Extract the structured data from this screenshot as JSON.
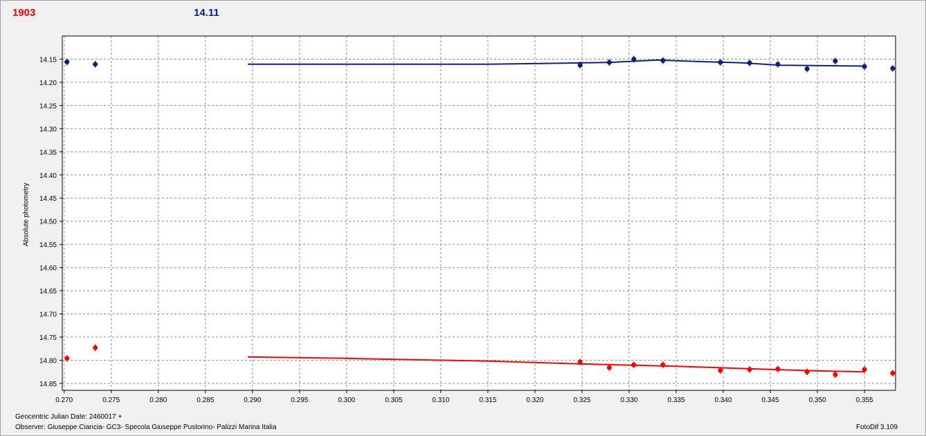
{
  "header": {
    "left_value": "1903",
    "right_value": "14.11"
  },
  "footer": {
    "julian": "Geocentric Julian Date: 2460017 +",
    "observer": "Observer: Giuseppe Ciancia- GC3- Specola Giuseppe Pustorino- Palizzi Marina Italia",
    "software": "FotoDif 3.109"
  },
  "chart_data": {
    "type": "scatter",
    "ylabel": "Absolute photometry",
    "xlabel": "",
    "xlim": [
      0.2698,
      0.3583
    ],
    "ylim": [
      14.1,
      14.865
    ],
    "y_inverted": true,
    "grid": true,
    "x_ticks": [
      "0.270",
      "0.275",
      "0.280",
      "0.285",
      "0.290",
      "0.295",
      "0.300",
      "0.305",
      "0.310",
      "0.315",
      "0.320",
      "0.325",
      "0.330",
      "0.335",
      "0.340",
      "0.345",
      "0.350",
      "0.355"
    ],
    "y_ticks": [
      "14.15",
      "14.20",
      "14.25",
      "14.30",
      "14.35",
      "14.40",
      "14.45",
      "14.50",
      "14.55",
      "14.60",
      "14.65",
      "14.70",
      "14.75",
      "14.80",
      "14.85"
    ],
    "series": [
      {
        "color": "#0b1f86",
        "points": [
          [
            0.2703,
            14.156
          ],
          [
            0.2733,
            14.161
          ],
          [
            0.3248,
            14.163
          ],
          [
            0.3279,
            14.157
          ],
          [
            0.3305,
            14.15
          ],
          [
            0.3336,
            14.153
          ],
          [
            0.3397,
            14.157
          ],
          [
            0.3428,
            14.158
          ],
          [
            0.3458,
            14.161
          ],
          [
            0.3489,
            14.171
          ],
          [
            0.3519,
            14.154
          ],
          [
            0.355,
            14.166
          ],
          [
            0.358,
            14.17
          ]
        ],
        "trend": [
          [
            0.2895,
            14.161
          ],
          [
            0.315,
            14.161
          ],
          [
            0.322,
            14.159
          ],
          [
            0.328,
            14.157
          ],
          [
            0.333,
            14.152
          ],
          [
            0.337,
            14.155
          ],
          [
            0.342,
            14.158
          ],
          [
            0.346,
            14.163
          ],
          [
            0.355,
            14.165
          ]
        ]
      },
      {
        "color": "#ff0000",
        "points": [
          [
            0.2703,
            14.796
          ],
          [
            0.2733,
            14.773
          ],
          [
            0.3248,
            14.804
          ],
          [
            0.3279,
            14.816
          ],
          [
            0.3305,
            14.81
          ],
          [
            0.3336,
            14.81
          ],
          [
            0.3397,
            14.822
          ],
          [
            0.3428,
            14.82
          ],
          [
            0.3458,
            14.819
          ],
          [
            0.3489,
            14.825
          ],
          [
            0.3519,
            14.831
          ],
          [
            0.355,
            14.82
          ],
          [
            0.358,
            14.828
          ]
        ],
        "trend": [
          [
            0.2895,
            14.793
          ],
          [
            0.3,
            14.796
          ],
          [
            0.315,
            14.802
          ],
          [
            0.325,
            14.808
          ],
          [
            0.335,
            14.813
          ],
          [
            0.342,
            14.818
          ],
          [
            0.35,
            14.823
          ],
          [
            0.355,
            14.825
          ]
        ]
      }
    ]
  }
}
